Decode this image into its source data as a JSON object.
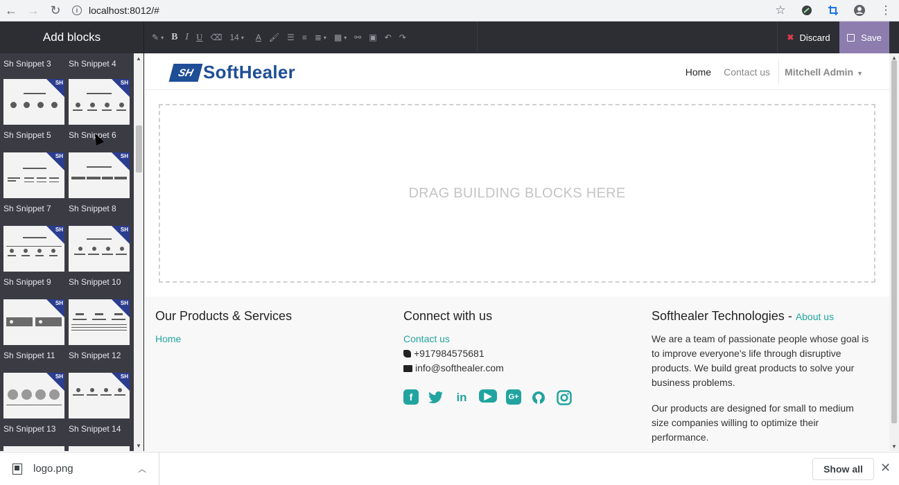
{
  "browser": {
    "url": "localhost:8012/#",
    "back_icon": "←",
    "forward_icon": "→",
    "reload_icon": "↻",
    "star_icon": "☆",
    "menu_icon": "⋮"
  },
  "editor": {
    "panel_title": "Add blocks",
    "font_size": "14",
    "discard_label": "Discard",
    "save_label": "Save"
  },
  "snippets": [
    {
      "label": "Sh Snippet 3"
    },
    {
      "label": "Sh Snippet 4"
    },
    {
      "label": "Sh Snippet 5"
    },
    {
      "label": "Sh Snippet 6"
    },
    {
      "label": "Sh Snippet 7"
    },
    {
      "label": "Sh Snippet 8"
    },
    {
      "label": "Sh Snippet 9"
    },
    {
      "label": "Sh Snippet 10"
    },
    {
      "label": "Sh Snippet 11"
    },
    {
      "label": "Sh Snippet 12"
    },
    {
      "label": "Sh Snippet 13"
    },
    {
      "label": "Sh Snippet 14"
    }
  ],
  "site": {
    "logo_mark": "SH",
    "logo_text": "SoftHealer",
    "menu": {
      "home": "Home",
      "contact": "Contact us",
      "user": "Mitchell Admin"
    },
    "dropzone_text": "DRAG BUILDING BLOCKS HERE"
  },
  "footer": {
    "products": {
      "title": "Our Products & Services",
      "home_link": "Home"
    },
    "connect": {
      "title": "Connect with us",
      "contact_link": "Contact us",
      "phone": "+917984575681",
      "email": "info@softhealer.com"
    },
    "about": {
      "title": "Softhealer Technologies",
      "title_sep": " - ",
      "about_link": "About us",
      "para1": "We are a team of passionate people whose goal is to improve everyone's life through disruptive products. We build great products to solve your business problems.",
      "para2": "Our products are designed for small to medium size companies willing to optimize their performance."
    }
  },
  "downloads": {
    "file_name": "logo.png",
    "show_all": "Show all"
  },
  "colors": {
    "accent": "#21a4a0",
    "save_bg": "#8c7dae",
    "panel_bg": "#3b3b44",
    "toolbar_bg": "#2d2d34"
  }
}
